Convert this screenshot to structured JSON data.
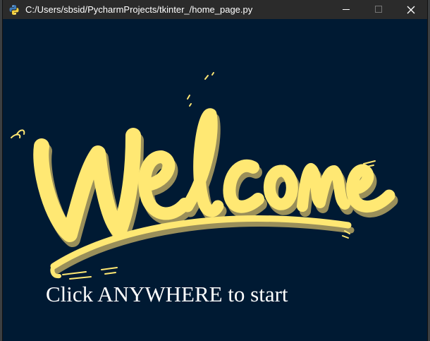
{
  "window": {
    "title": "C:/Users/sbsid/PycharmProjects/tkinter_/home_page.py",
    "app_icon": "python-icon",
    "controls": {
      "minimize_icon": "minimize-icon",
      "maximize_icon": "maximize-icon",
      "close_icon": "close-icon"
    }
  },
  "content": {
    "background_color": "#001a33",
    "welcome_image": {
      "icon": "welcome-lettering",
      "text": "Welcome",
      "color": "#ffe873",
      "shadow_color": "#9a8f5a"
    },
    "prompt": "Click ANYWHERE to start"
  }
}
